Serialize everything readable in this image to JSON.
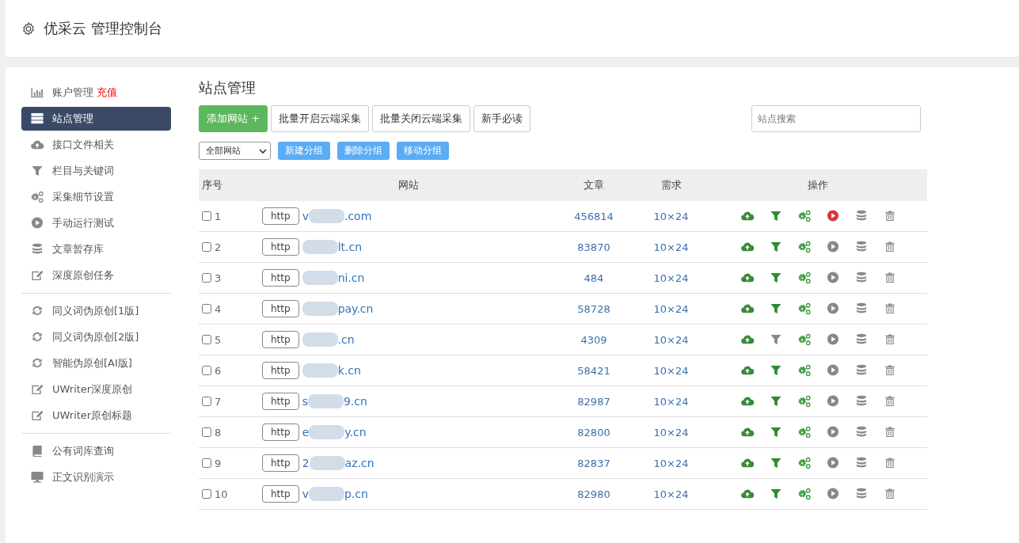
{
  "header": {
    "title": "优采云 管理控制台"
  },
  "sidebar": {
    "groups": [
      {
        "items": [
          {
            "kind": "chart",
            "label": "账户管理",
            "badge": "充值",
            "selected": false
          },
          {
            "kind": "server",
            "label": "站点管理",
            "selected": true
          },
          {
            "kind": "cloud",
            "label": "接口文件相关",
            "selected": false
          },
          {
            "kind": "filter",
            "label": "栏目与关键词",
            "selected": false
          },
          {
            "kind": "gears",
            "label": "采集细节设置",
            "selected": false
          },
          {
            "kind": "play",
            "label": "手动运行测试",
            "selected": false
          },
          {
            "kind": "database",
            "label": "文章暂存库",
            "selected": false
          },
          {
            "kind": "edit",
            "label": "深度原创任务",
            "selected": false
          }
        ]
      },
      {
        "items": [
          {
            "kind": "refresh",
            "label": "同义词伪原创[1版]",
            "selected": false
          },
          {
            "kind": "refresh",
            "label": "同义词伪原创[2版]",
            "selected": false
          },
          {
            "kind": "refresh",
            "label": "智能伪原创[AI版]",
            "selected": false
          },
          {
            "kind": "edit",
            "label": "UWriter深度原创",
            "selected": false
          },
          {
            "kind": "edit",
            "label": "UWriter原创标题",
            "selected": false
          }
        ]
      },
      {
        "items": [
          {
            "kind": "book",
            "label": "公有词库查询",
            "selected": false
          },
          {
            "kind": "monitor",
            "label": "正文识别演示",
            "selected": false
          }
        ]
      }
    ]
  },
  "content": {
    "title": "站点管理",
    "toolbar": [
      {
        "kind": "primary",
        "label": "添加网站 +"
      },
      {
        "kind": "default",
        "label": "批量开启云端采集"
      },
      {
        "kind": "default",
        "label": "批量关闭云端采集"
      },
      {
        "kind": "default",
        "label": "新手必读"
      }
    ],
    "search": {
      "placeholder": "站点搜索"
    },
    "group_select": {
      "value": "全部网站"
    },
    "group_buttons": [
      "新建分组",
      "删除分组",
      "移动分组"
    ],
    "table": {
      "columns": [
        "序号",
        "网站",
        "文章",
        "需求",
        "操作"
      ],
      "rows": [
        {
          "checked": false,
          "index": "1",
          "protocol": "http",
          "domain_head": "v",
          "domain_tail": ".com",
          "articles": "456814",
          "demand": "10×24",
          "filter_on": true,
          "running": true
        },
        {
          "checked": false,
          "index": "2",
          "protocol": "http",
          "domain_tail": "lt.cn",
          "articles": "83870",
          "demand": "10×24",
          "filter_on": true,
          "running": false
        },
        {
          "checked": false,
          "index": "3",
          "protocol": "http",
          "domain_tail": "ni.cn",
          "articles": "484",
          "demand": "10×24",
          "filter_on": true,
          "running": false
        },
        {
          "checked": false,
          "index": "4",
          "protocol": "http",
          "domain_tail": "pay.cn",
          "articles": "58728",
          "demand": "10×24",
          "filter_on": true,
          "running": false
        },
        {
          "checked": false,
          "index": "5",
          "protocol": "http",
          "domain_tail": ".cn",
          "articles": "4309",
          "demand": "10×24",
          "filter_on": false,
          "running": false
        },
        {
          "checked": false,
          "index": "6",
          "protocol": "http",
          "domain_tail": "k.cn",
          "articles": "58421",
          "demand": "10×24",
          "filter_on": true,
          "running": false
        },
        {
          "checked": false,
          "index": "7",
          "protocol": "http",
          "domain_head": "s",
          "domain_tail": "9.cn",
          "articles": "82987",
          "demand": "10×24",
          "filter_on": true,
          "running": false
        },
        {
          "checked": false,
          "index": "8",
          "protocol": "http",
          "domain_head": "e",
          "domain_tail": "y.cn",
          "articles": "82800",
          "demand": "10×24",
          "filter_on": true,
          "running": false
        },
        {
          "checked": false,
          "index": "9",
          "protocol": "http",
          "domain_head": "2",
          "domain_tail": "az.cn",
          "articles": "82837",
          "demand": "10×24",
          "filter_on": true,
          "running": false
        },
        {
          "checked": false,
          "index": "10",
          "protocol": "http",
          "domain_head": "v",
          "domain_tail": "p.cn",
          "articles": "82980",
          "demand": "10×24",
          "filter_on": true,
          "running": false
        }
      ]
    }
  }
}
